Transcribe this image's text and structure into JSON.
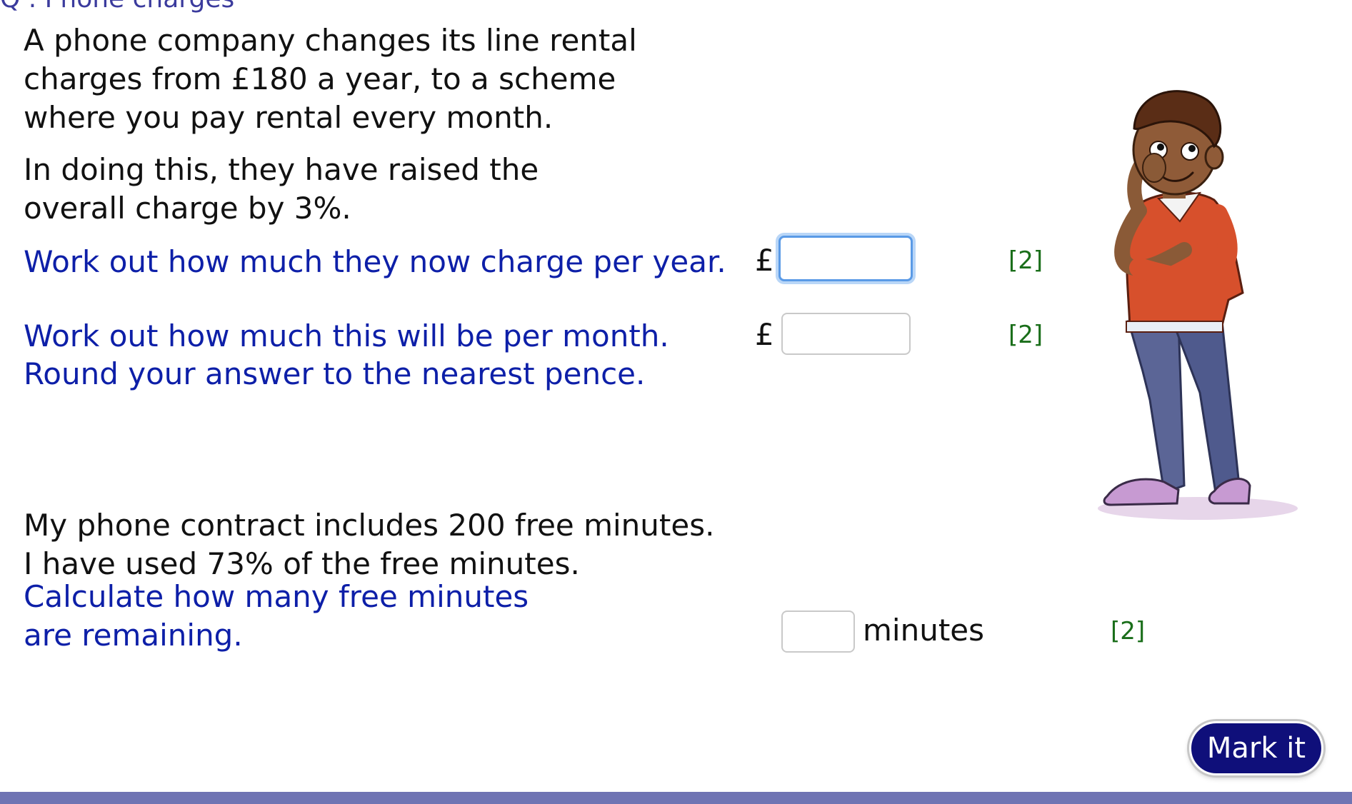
{
  "header": {
    "title_fragment": "Q . Phone charges"
  },
  "intro": {
    "line1": "A phone company changes its line rental",
    "line2": "charges from £180 a year, to a scheme",
    "line3": "where you pay rental every month.",
    "line4": "In doing this, they have raised the",
    "line5": "overall charge by 3%."
  },
  "question1": {
    "prompt": "Work out how much they now charge per year.",
    "currency": "£",
    "value": "",
    "marks": "[2]"
  },
  "question2": {
    "prompt_line1": "Work out how much this will be per month.",
    "prompt_line2": "Round your answer to the nearest pence.",
    "currency": "£",
    "value": "",
    "marks": "[2]"
  },
  "context2": {
    "line1": "My phone contract includes 200 free minutes.",
    "line2": "I have used 73% of the free minutes."
  },
  "question3": {
    "prompt_line1": "Calculate how many free minutes",
    "prompt_line2": "are remaining.",
    "value": "",
    "unit": "minutes",
    "marks": "[2]"
  },
  "actions": {
    "mark_label": "Mark it"
  },
  "colors": {
    "question_text": "#0d1fa8",
    "marks_text": "#1a6e1a",
    "button_bg": "#0f0f7a",
    "bottom_bar": "#6f74b3",
    "focus_ring": "#5a9ae6"
  },
  "illustration": {
    "icon": "thinking-boy-illustration"
  }
}
